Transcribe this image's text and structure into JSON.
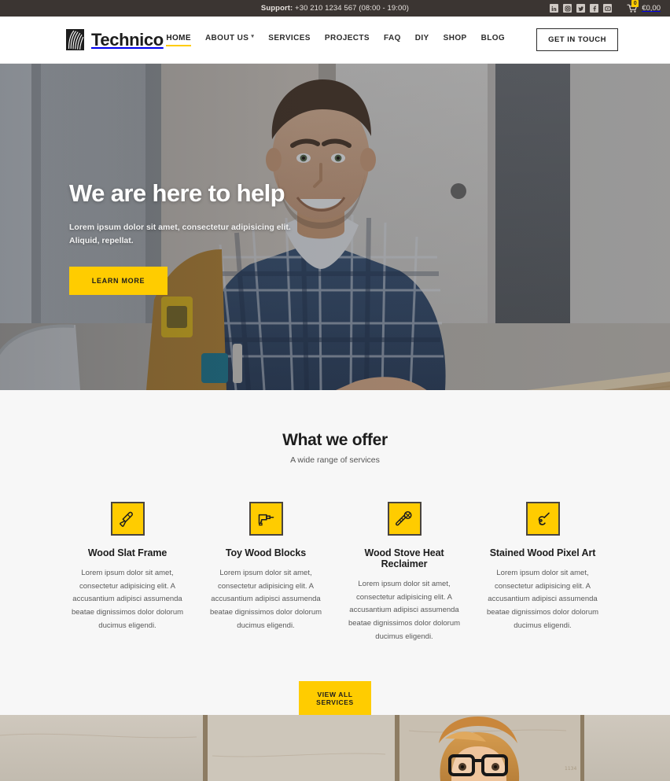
{
  "topbar": {
    "support_label": "Support:",
    "support_phone": "+30 210 1234 567 (08:00 - 19:00)",
    "social": [
      {
        "name": "linkedin-icon",
        "glyph": "in"
      },
      {
        "name": "instagram-icon",
        "glyph": ""
      },
      {
        "name": "twitter-icon",
        "glyph": ""
      },
      {
        "name": "facebook-icon",
        "glyph": "f"
      },
      {
        "name": "youtube-icon",
        "glyph": ""
      }
    ],
    "cart_count": "0",
    "cart_total": "€0,00"
  },
  "header": {
    "brand_name": "Technico",
    "nav": [
      {
        "label": "HOME",
        "active": true,
        "caret": false
      },
      {
        "label": "ABOUT US",
        "active": false,
        "caret": true
      },
      {
        "label": "SERVICES",
        "active": false,
        "caret": false
      },
      {
        "label": "PROJECTS",
        "active": false,
        "caret": false
      },
      {
        "label": "FAQ",
        "active": false,
        "caret": false
      },
      {
        "label": "DIY",
        "active": false,
        "caret": false
      },
      {
        "label": "SHOP",
        "active": false,
        "caret": false
      },
      {
        "label": "BLOG",
        "active": false,
        "caret": false
      }
    ],
    "cta_label": "GET IN TOUCH"
  },
  "hero": {
    "title": "We are here to help",
    "subtitle": "Lorem ipsum dolor sit amet, consectetur adipisicing elit. Aliquid, repellat.",
    "button_label": "LEARN MORE"
  },
  "services_section": {
    "title": "What we offer",
    "subtitle": "A wide range of services",
    "cta_label": "VIEW ALL SERVICES",
    "items": [
      {
        "icon": "chisel-icon",
        "title": "Wood Slat Frame",
        "text": "Lorem ipsum dolor sit amet, consectetur adipisicing elit. A accusantium adipisci assumenda beatae dignissimos dolor dolorum ducimus eligendi."
      },
      {
        "icon": "drill-icon",
        "title": "Toy Wood Blocks",
        "text": "Lorem ipsum dolor sit amet, consectetur adipisicing elit. A accusantium adipisci assumenda beatae dignissimos dolor dolorum ducimus eligendi."
      },
      {
        "icon": "screw-icon",
        "title": "Wood Stove Heat Reclaimer",
        "text": "Lorem ipsum dolor sit amet, consectetur adipisicing elit. A accusantium adipisci assumenda beatae dignissimos dolor dolorum ducimus eligendi."
      },
      {
        "icon": "wrench-icon",
        "title": "Stained Wood Pixel Art",
        "text": "Lorem ipsum dolor sit amet, consectetur adipisicing elit. A accusantium adipisci assumenda beatae dignissimos dolor dolorum ducimus eligendi."
      }
    ]
  },
  "colors": {
    "accent_yellow": "#ffcc00",
    "topbar_dark": "#3b3532",
    "text_dark": "#1d1d1d",
    "section_bg": "#f7f7f7"
  }
}
